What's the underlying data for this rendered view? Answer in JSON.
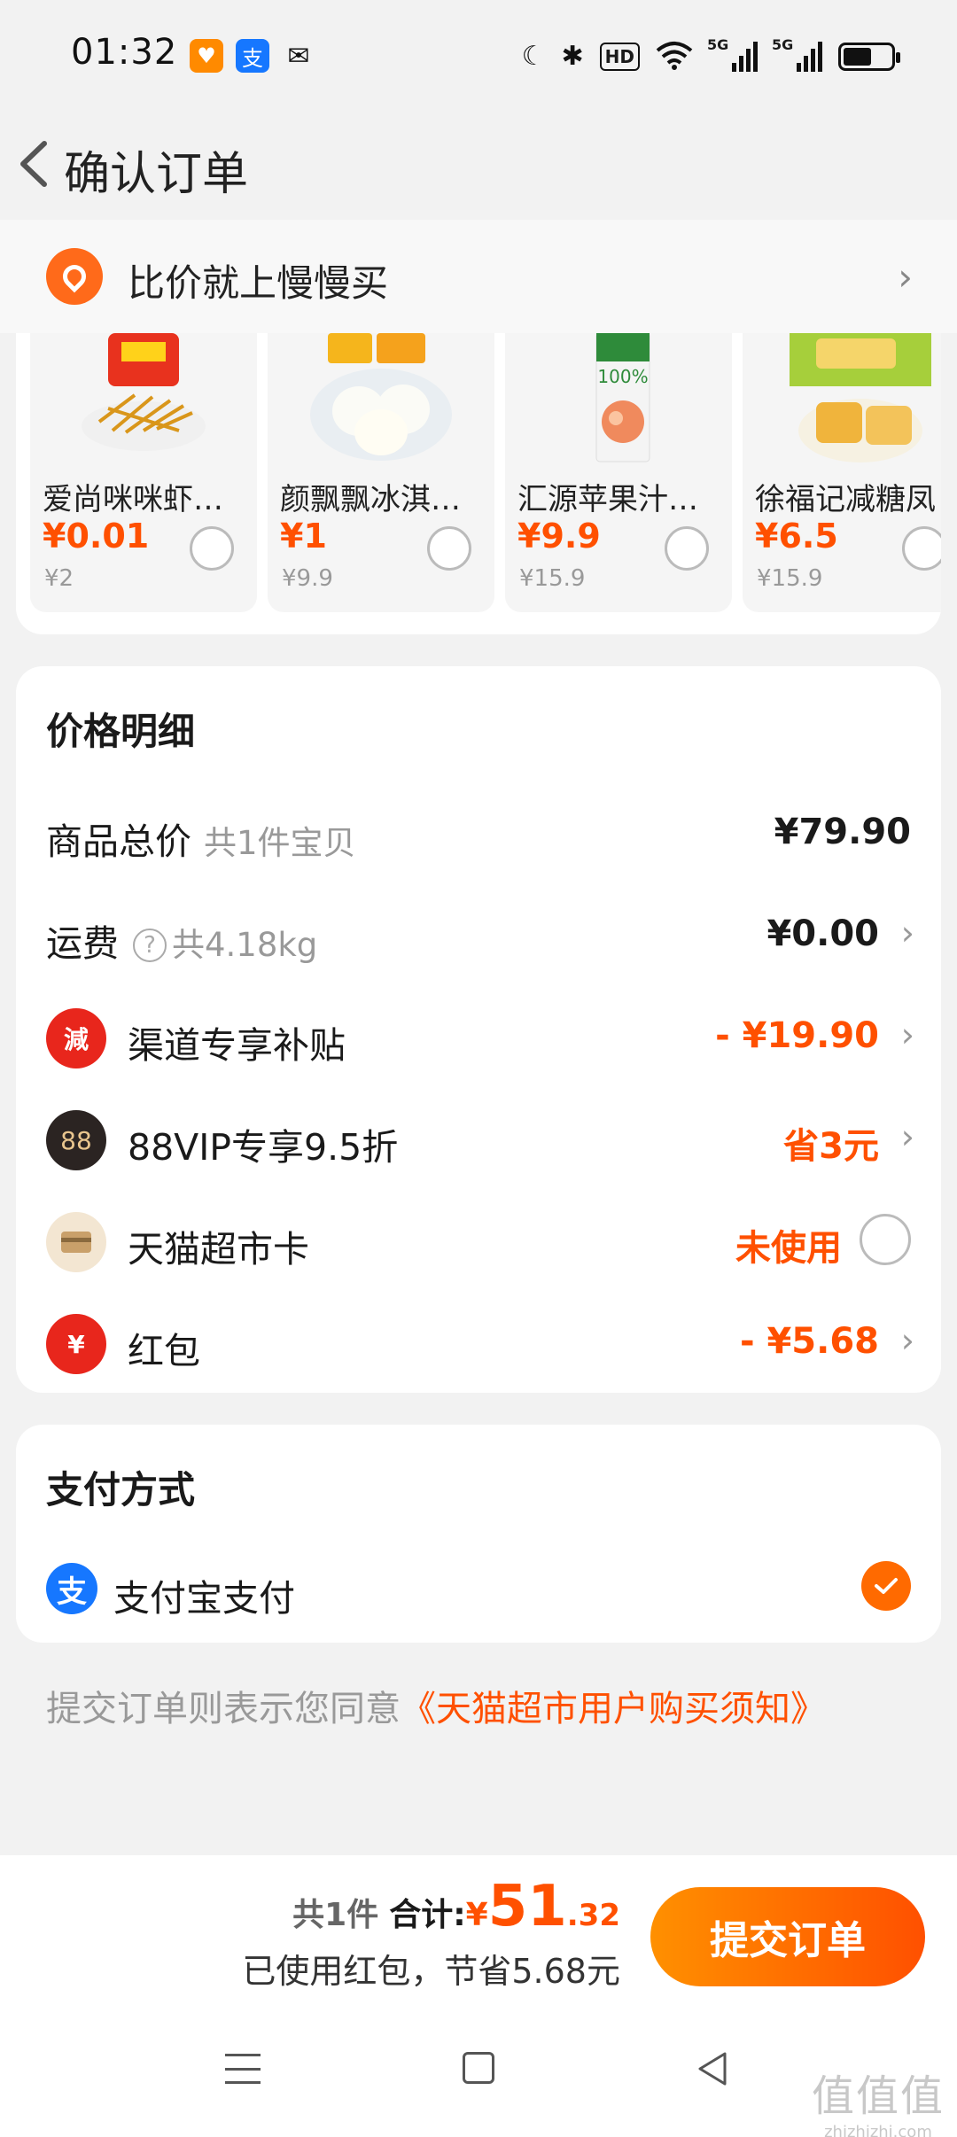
{
  "status_bar": {
    "time": "01:32",
    "hd_label": "HD",
    "signal1_label": "5G",
    "signal2_label": "5G",
    "icons": [
      "moon-icon",
      "bluetooth-icon",
      "wifi-icon",
      "battery-icon"
    ]
  },
  "nav": {
    "title": "确认订单"
  },
  "banner": {
    "text": "比价就上慢慢买"
  },
  "products": [
    {
      "name": "爱尚咪咪虾条...",
      "price": "¥0.01",
      "orig": "¥2"
    },
    {
      "name": "颜飘飘冰淇淋...",
      "price": "¥1",
      "orig": "¥9.9"
    },
    {
      "name": "汇源苹果汁大...",
      "price": "¥9.9",
      "orig": "¥15.9"
    },
    {
      "name": "徐福记减糖凤",
      "price": "¥6.5",
      "orig": "¥15.9"
    }
  ],
  "price_detail": {
    "title": "价格明细",
    "goods_total": {
      "label": "商品总价",
      "sub": "共1件宝贝",
      "value": "¥79.90"
    },
    "shipping": {
      "label": "运费",
      "sub": "共4.18kg",
      "value": "¥0.00"
    },
    "channel_subsidy": {
      "badge": "減",
      "label": "渠道专享补贴",
      "value": "- ¥19.90"
    },
    "vip": {
      "badge": "88",
      "label": "88VIP专享9.5折",
      "value": "省3元"
    },
    "card": {
      "label": "天猫超市卡",
      "value": "未使用"
    },
    "red_packet": {
      "badge": "¥",
      "label": "红包",
      "value": "- ¥5.68"
    }
  },
  "payment": {
    "title": "支付方式",
    "method_icon_char": "支",
    "method": "支付宝支付"
  },
  "agreement": {
    "prefix": "提交订单则表示您同意",
    "link": "《天猫超市用户购买须知》"
  },
  "bottom": {
    "count": "共1件",
    "total_label": "合计:",
    "yen": "¥",
    "total_int": "51",
    "total_dec": ".32",
    "saved": "已使用红包，节省5.68元",
    "submit": "提交订单"
  },
  "watermark": {
    "big": "值值值",
    "small": "zhizhizhi.com"
  },
  "colors": {
    "accent": "#ff5000",
    "alipay": "#1677ff",
    "background": "#f2f2f2"
  }
}
